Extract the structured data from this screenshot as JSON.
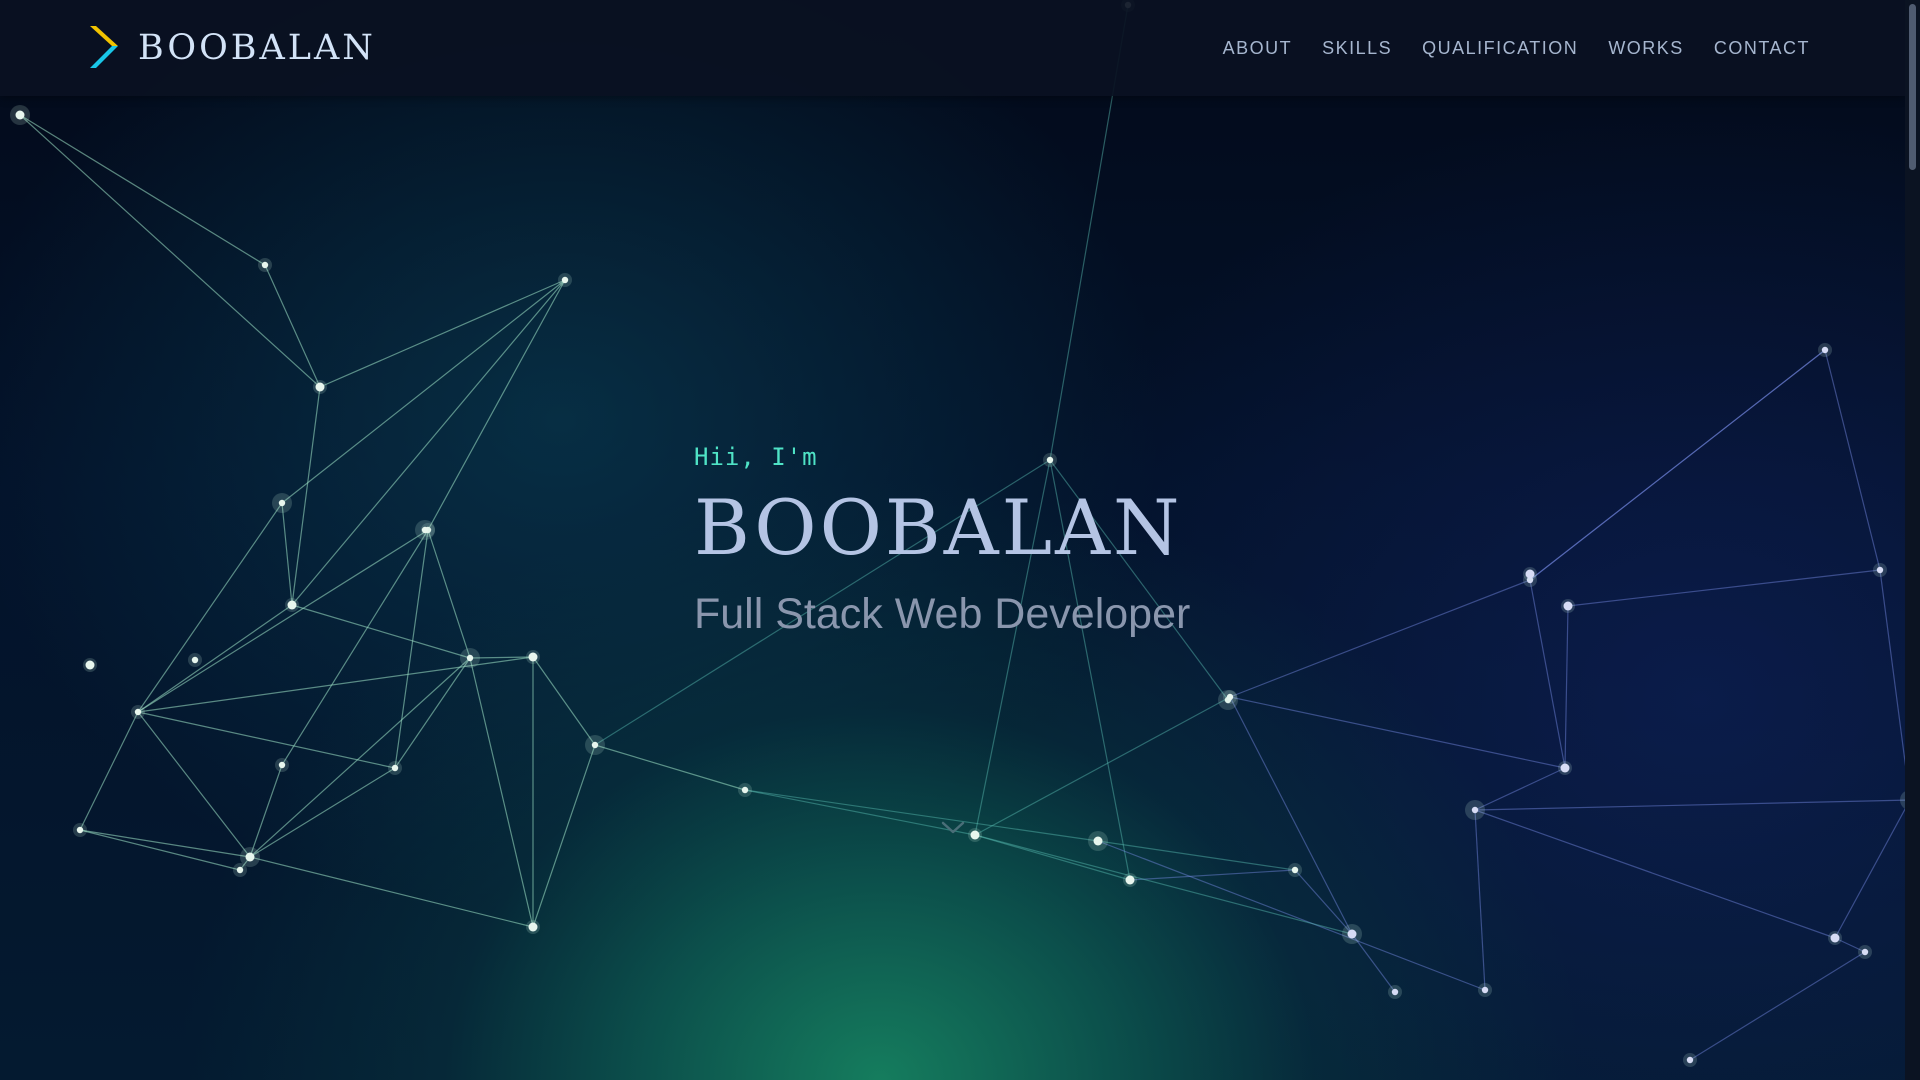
{
  "header": {
    "logo_icon": "chevron-right-icon",
    "logo_text": "BOOBALAN",
    "logo_colors": {
      "top": "#f2c300",
      "bottom": "#19c6e8"
    },
    "nav": [
      {
        "label": "ABOUT"
      },
      {
        "label": "SKILLS"
      },
      {
        "label": "QUALIFICATION"
      },
      {
        "label": "WORKS"
      },
      {
        "label": "CONTACT"
      }
    ]
  },
  "hero": {
    "greeting": "Hii, I'm",
    "name": "BOOBALAN",
    "role": "Full Stack Web Developer",
    "scroll_icon": "chevron-down-icon",
    "background": "animated-network-particles"
  },
  "theme": {
    "accent": "#4fe3c6",
    "nav_text": "#a6b6cf",
    "name_text": "#b4c4e4",
    "role_text": "#8a96ad",
    "navbar_bg": "#0a1122"
  }
}
